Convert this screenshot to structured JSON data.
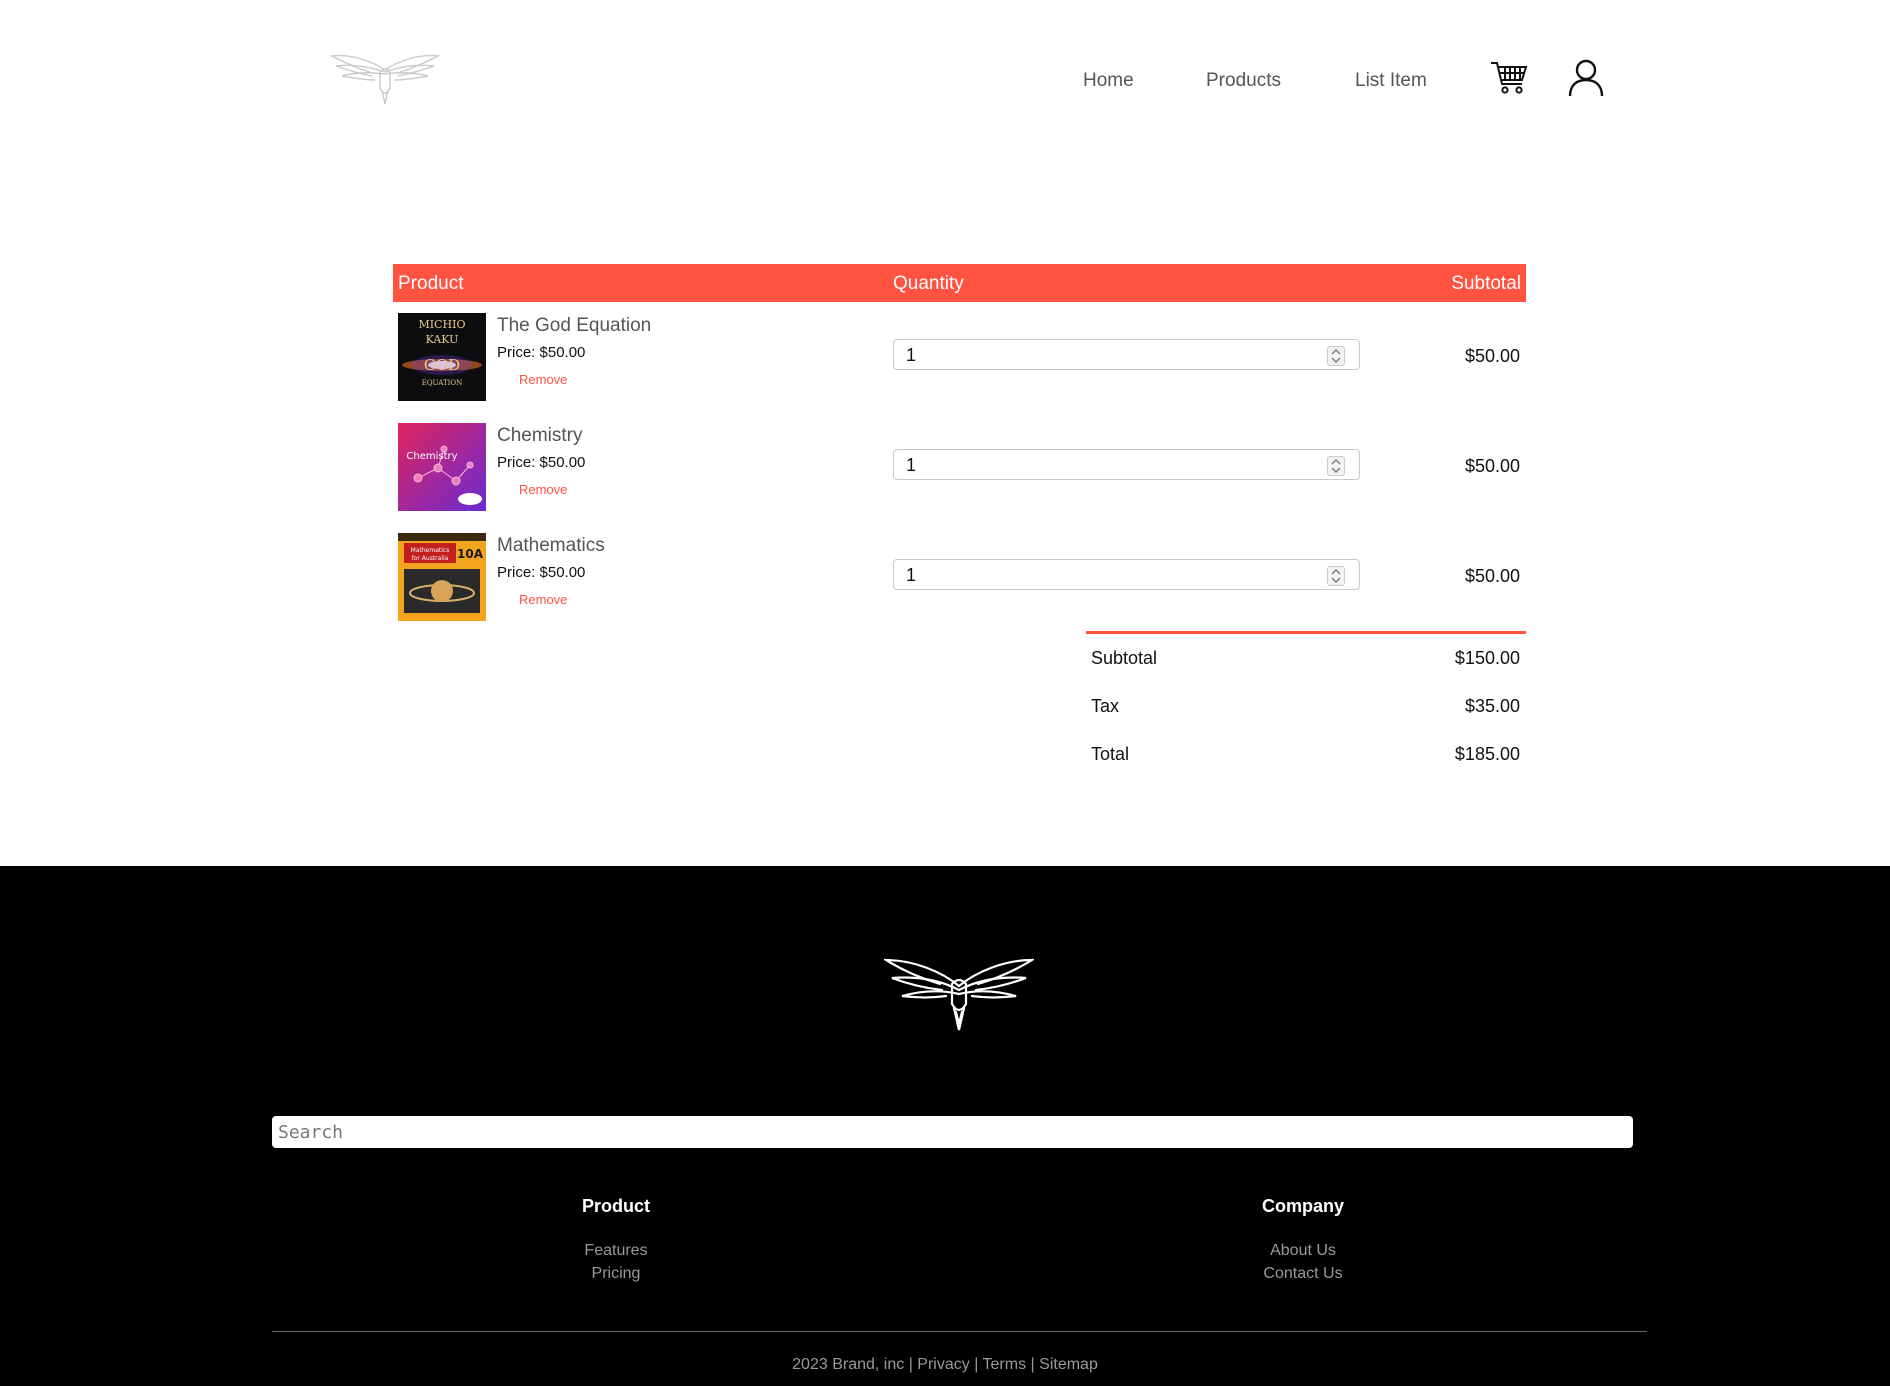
{
  "header": {
    "nav": [
      {
        "label": "Home"
      },
      {
        "label": "Products"
      },
      {
        "label": "List Item"
      }
    ]
  },
  "cart": {
    "columns": {
      "product": "Product",
      "quantity": "Quantity",
      "subtotal": "Subtotal"
    },
    "items": [
      {
        "name": "The God Equation",
        "price": "Price: $50.00",
        "remove": "Remove",
        "quantity": "1",
        "subtotal": "$50.00",
        "cover_title": "MICHIO KAKU GOD EQUATION"
      },
      {
        "name": "Chemistry",
        "price": "Price: $50.00",
        "remove": "Remove",
        "quantity": "1",
        "subtotal": "$50.00",
        "cover_title": "Chemistry"
      },
      {
        "name": "Mathematics",
        "price": "Price: $50.00",
        "remove": "Remove",
        "quantity": "1",
        "subtotal": "$50.00",
        "cover_title": "Mathematics for Australia 10A"
      }
    ],
    "totals": [
      {
        "label": "Subtotal",
        "value": "$150.00"
      },
      {
        "label": "Tax",
        "value": "$35.00"
      },
      {
        "label": "Total",
        "value": "$185.00"
      }
    ]
  },
  "footer": {
    "search_placeholder": "Search",
    "columns": [
      {
        "heading": "Product",
        "links": [
          "Features",
          "Pricing"
        ]
      },
      {
        "heading": "Company",
        "links": [
          "About Us",
          "Contact Us"
        ]
      }
    ],
    "bottom": {
      "copyright": "2023 Brand, inc",
      "sep": "|",
      "links": [
        "Privacy",
        "Terms",
        "Sitemap"
      ]
    }
  },
  "colors": {
    "accent": "#ff5240",
    "footer_bg": "#000000"
  }
}
